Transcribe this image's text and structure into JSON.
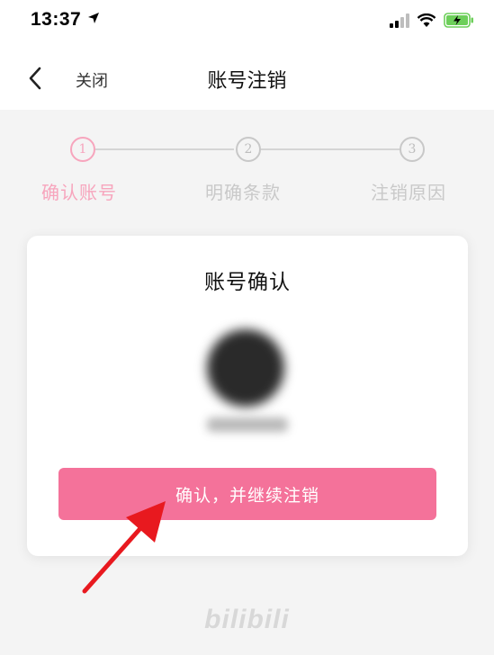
{
  "status_bar": {
    "time": "13:37"
  },
  "navbar": {
    "close_label": "关闭",
    "title": "账号注销"
  },
  "stepper": {
    "steps": [
      {
        "number": "1",
        "label": "确认账号"
      },
      {
        "number": "2",
        "label": "明确条款"
      },
      {
        "number": "3",
        "label": "注销原因"
      }
    ],
    "active_step": 1
  },
  "card": {
    "title": "账号确认",
    "confirm_button": "确认，并继续注销"
  },
  "footer": {
    "logo_text": "bilibili"
  },
  "colors": {
    "accent_pink": "#f4729a",
    "step_active": "#f7a5bd",
    "annotation_arrow": "#e8191f"
  }
}
